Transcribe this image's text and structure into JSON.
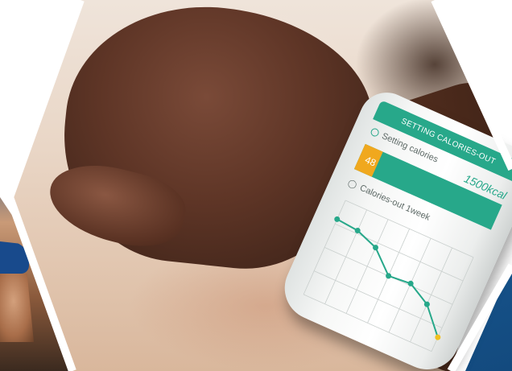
{
  "screen": {
    "header": "SETTING CALORIES-OUT",
    "setting_label": "Setting calories",
    "setting_value": "48",
    "setting_target": "1500kcal",
    "setting_progress_fraction": 0.13,
    "chart_label": "Calories-out 1week",
    "icons": {
      "setting": "ring-icon",
      "chart": "lightbulb-icon"
    }
  },
  "chart_data": {
    "type": "line",
    "title": "Calories-out 1week",
    "x": [
      1,
      2,
      3,
      4,
      5,
      6,
      7
    ],
    "series": [
      {
        "values": [
          80,
          78,
          70,
          50,
          52,
          40,
          15
        ]
      }
    ],
    "ylim": [
      0,
      100
    ],
    "grid": true
  },
  "colors": {
    "accent": "#27a88a",
    "bar_fill": "#f0a81e",
    "last_point": "#f0c020",
    "left_hex": "#1f5f9e",
    "right_hex": "#1f6fb6"
  }
}
